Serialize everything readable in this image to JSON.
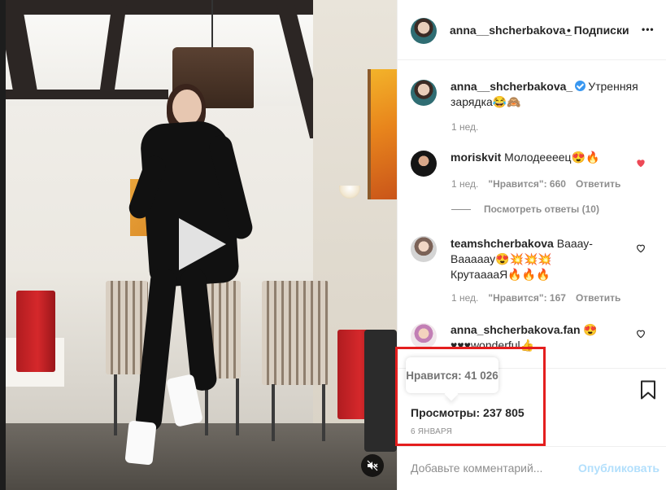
{
  "post": {
    "author": "anna__shcherbakova_",
    "follow_label": "• Подписки",
    "more_label": "•••",
    "caption": "Утренняя зарядка😂🙈",
    "caption_time": "1 нед."
  },
  "comments": [
    {
      "username": "moriskvit",
      "text": "Молодеееец😍🔥",
      "time": "1 нед.",
      "likes": "\"Нравится\": 660",
      "reply": "Ответить",
      "liked": true,
      "view_replies": "Посмотреть ответы (10)"
    },
    {
      "username": "teamshcherbakova",
      "text": "Вааау-Вааааау😍💥💥💥",
      "text2": "КрутааааЯ🔥🔥🔥",
      "time": "1 нед.",
      "likes": "\"Нравится\": 167",
      "reply": "Ответить",
      "liked": false
    },
    {
      "username": "anna_shcherbakova.fan",
      "text": "😍",
      "text2": "♥♥♥wonderful👍",
      "liked": false
    }
  ],
  "stats": {
    "likes_tooltip": "Нравится: 41 026",
    "views": "Просмотры: 237 805",
    "date": "6 января"
  },
  "composer": {
    "placeholder": "Добавьте комментарий...",
    "publish_label": "Опубликовать"
  },
  "colors": {
    "highlight": "#e41e1e",
    "liked_heart": "#ed4956",
    "link_blue_disabled": "#b2dffc",
    "verified": "#3897f0"
  }
}
